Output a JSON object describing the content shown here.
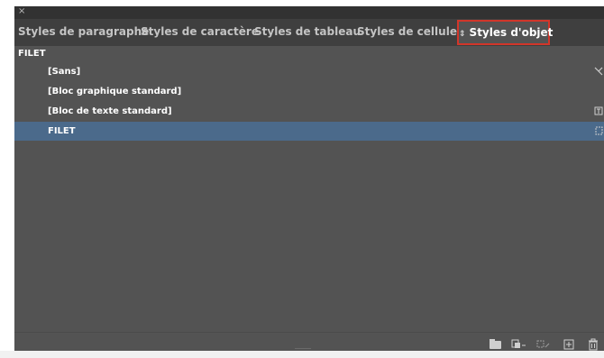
{
  "window": {
    "close_glyph": "×"
  },
  "tabs": [
    {
      "label": "Styles de paragraphe",
      "active": false
    },
    {
      "label": "Styles de caractère",
      "active": false
    },
    {
      "label": "Styles de tableau",
      "active": false
    },
    {
      "label": "Styles de cellule",
      "active": false
    },
    {
      "label": "Styles d'objet",
      "active": true,
      "prefix_glyph": "⇕"
    }
  ],
  "current_style": "FILET",
  "list": [
    {
      "label": "[Sans]",
      "icon": "no-style-icon",
      "selected": false
    },
    {
      "label": "[Bloc graphique standard]",
      "icon": "",
      "selected": false
    },
    {
      "label": "[Bloc de texte standard]",
      "icon": "text-frame-icon",
      "selected": false
    },
    {
      "label": "FILET",
      "icon": "frame-icon",
      "selected": true
    }
  ],
  "footer_icons": [
    "folder-icon",
    "style-override-icon",
    "clear-override-icon",
    "new-style-icon",
    "trash-icon"
  ],
  "colors": {
    "panel_bg": "#535353",
    "tab_bar_bg": "#3f3f3f",
    "selection": "#4b6a8b",
    "active_tab_border": "#d2362a"
  }
}
